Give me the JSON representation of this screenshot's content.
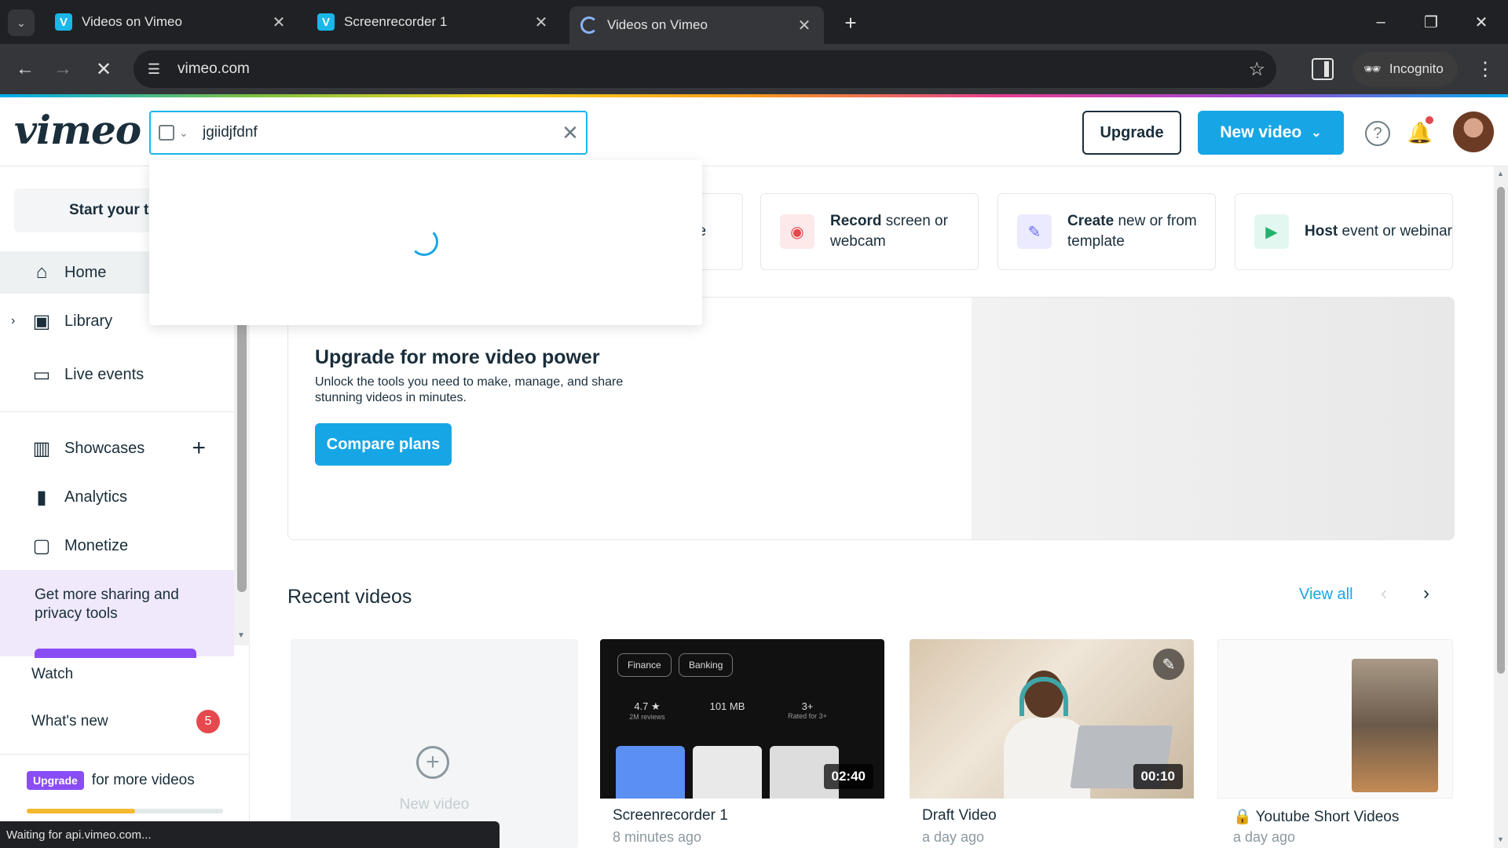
{
  "browser": {
    "tabs": [
      {
        "title": "Videos on Vimeo",
        "active": false
      },
      {
        "title": "Screenrecorder 1",
        "active": false
      },
      {
        "title": "Videos on Vimeo",
        "active": true
      }
    ],
    "url": "vimeo.com",
    "incognito_label": "Incognito",
    "status_text": "Waiting for api.vimeo.com..."
  },
  "header": {
    "logo": "vimeo",
    "search_value": "jgiidjfdnf",
    "upgrade_label": "Upgrade",
    "new_video_label": "New video"
  },
  "sidebar": {
    "start_trial_label": "Start your t",
    "items": [
      {
        "label": "Home",
        "icon": "home-icon"
      },
      {
        "label": "Library",
        "icon": "library-icon"
      },
      {
        "label": "Live events",
        "icon": "camera-icon"
      },
      {
        "label": "Showcases",
        "icon": "showcases-icon"
      },
      {
        "label": "Analytics",
        "icon": "analytics-icon"
      },
      {
        "label": "Monetize",
        "icon": "monetize-icon"
      }
    ],
    "promo_text": "Get more sharing and privacy tools",
    "watch_label": "Watch",
    "whats_new_label": "What's new",
    "whats_new_count": "5",
    "upgrade_badge": "Upgrade",
    "upgrade_text": "for more videos",
    "usage_fraction": 0.55
  },
  "quick_actions": [
    {
      "bold": "",
      "rest": "ve"
    },
    {
      "bold": "Record",
      "rest": "screen or webcam",
      "color": "#fde8ea"
    },
    {
      "bold": "Create",
      "rest": "new or from template",
      "color": "#ebeaff"
    },
    {
      "bold": "Host",
      "rest": "event or webinar",
      "color": "#e2f7ef"
    }
  ],
  "upgrade_card": {
    "title": "Upgrade for more video power",
    "description": "Unlock the tools you need to make, manage, and share stunning videos in minutes.",
    "button": "Compare plans"
  },
  "recent": {
    "title": "Recent videos",
    "view_all": "View all",
    "new_video_label": "New video",
    "videos": [
      {
        "title": "Screenrecorder 1",
        "time": "8 minutes ago",
        "duration": "02:40"
      },
      {
        "title": "Draft Video",
        "time": "a day ago",
        "duration": "00:10"
      },
      {
        "title": "Youtube Short Videos",
        "time": "a day ago",
        "duration": ""
      }
    ],
    "app_thumb": {
      "pills": [
        "Finance",
        "Banking"
      ],
      "stats": [
        "4.7 ★",
        "101 MB",
        "3+"
      ],
      "stat_sub": [
        "2M reviews",
        "",
        "Rated for 3+"
      ]
    }
  }
}
